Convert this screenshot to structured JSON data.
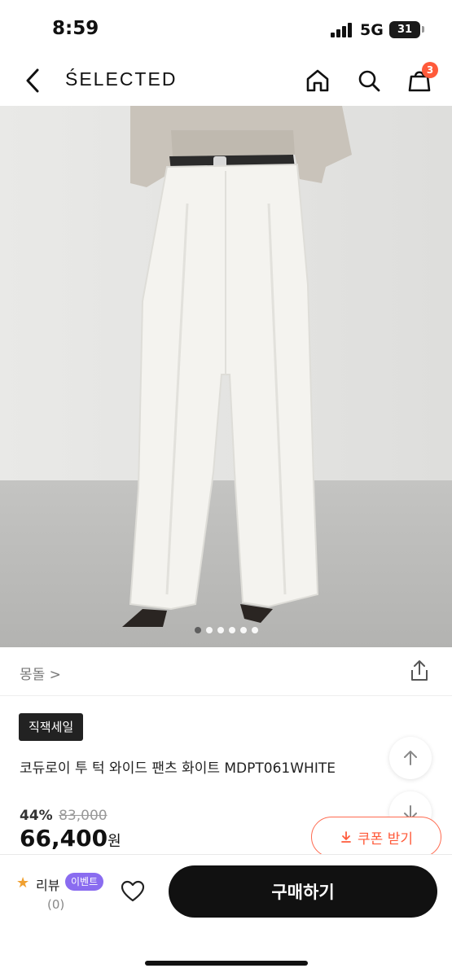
{
  "status_bar": {
    "time": "8:59",
    "network": "5G",
    "battery": "31"
  },
  "nav": {
    "brand": "ŚELECTED",
    "cart_count": "3"
  },
  "carousel": {
    "dot_count": 6,
    "active_index": 0
  },
  "seller": {
    "name": "몽돌 >"
  },
  "product": {
    "tag": "직잭세일",
    "title": "코듀로이 투 턱 와이드 팬츠 화이트 MDPT061WHITE",
    "discount": "44%",
    "original_price": "83,000",
    "price": "66,400",
    "currency": "원"
  },
  "coupon": {
    "label": "쿠폰 받기"
  },
  "bottom": {
    "review_label": "리뷰",
    "event_label": "이벤트",
    "review_count": "(0)",
    "buy_label": "구매하기"
  },
  "colors": {
    "accent": "#ff5a3a",
    "event": "#8a6cf0",
    "buy": "#111111"
  }
}
